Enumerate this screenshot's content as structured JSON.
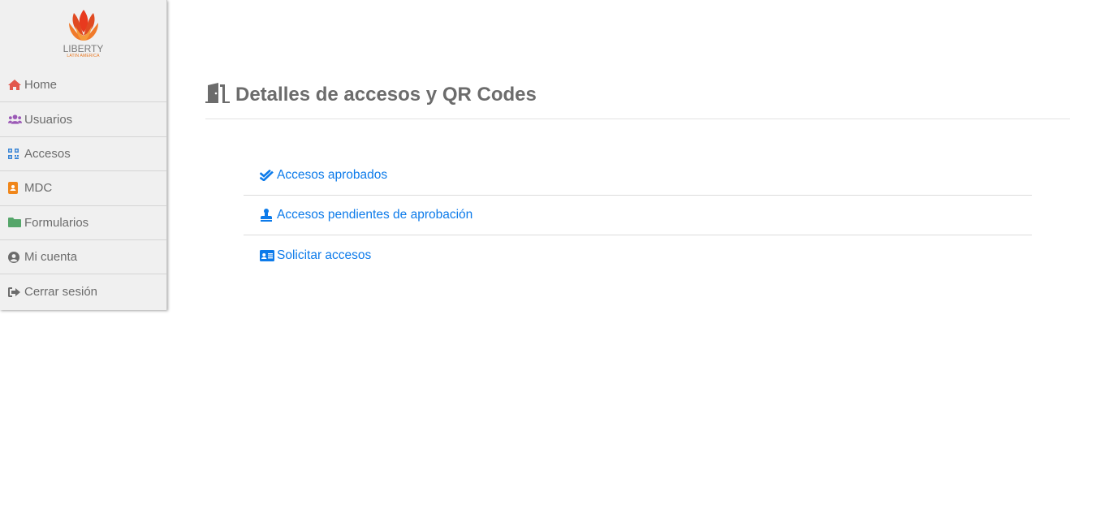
{
  "brand": {
    "name": "LIBERTY",
    "subtitle": "LATIN AMERICA"
  },
  "sidebar": {
    "items": [
      {
        "label": "Home",
        "icon": "home-icon",
        "color": "#e2574c"
      },
      {
        "label": "Usuarios",
        "icon": "users-icon",
        "color": "#9b59b6"
      },
      {
        "label": "Accesos",
        "icon": "qrcode-icon",
        "color": "#3b86d6"
      },
      {
        "label": "MDC",
        "icon": "address-book-icon",
        "color": "#f0861a"
      },
      {
        "label": "Formularios",
        "icon": "folder-icon",
        "color": "#55a66a"
      },
      {
        "label": "Mi cuenta",
        "icon": "user-circle-icon",
        "color": "#6c6c6c"
      },
      {
        "label": "Cerrar sesión",
        "icon": "sign-out-icon",
        "color": "#6c6c6c"
      }
    ]
  },
  "main": {
    "title": "Detalles de accesos y QR Codes",
    "title_icon": "door-open-icon",
    "links": [
      {
        "label": "Accesos aprobados",
        "icon": "check-double-icon"
      },
      {
        "label": "Accesos pendientes de aprobación",
        "icon": "stamp-icon"
      },
      {
        "label": "Solicitar accesos",
        "icon": "id-card-icon"
      }
    ],
    "link_color": "#0d7bea"
  }
}
